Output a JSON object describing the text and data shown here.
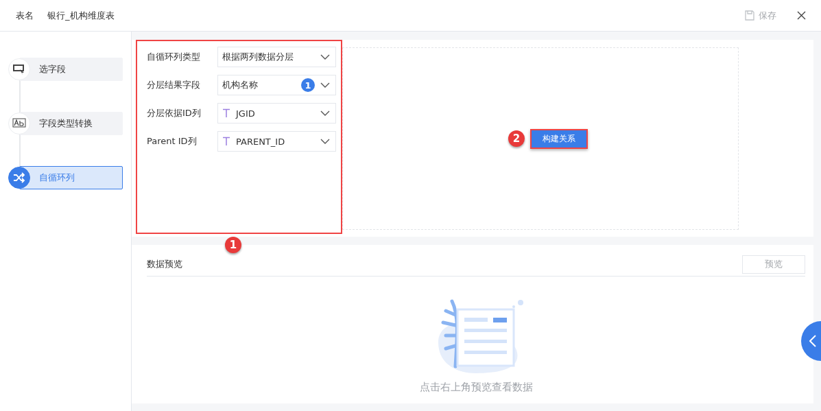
{
  "header": {
    "label": "表名",
    "table_name": "银行_机构维度表",
    "save": "保存"
  },
  "steps": [
    {
      "label": "选字段",
      "kind": "select",
      "selected": false
    },
    {
      "label": "字段类型转换",
      "kind": "convert",
      "selected": false
    },
    {
      "label": "自循环列",
      "kind": "shuffle",
      "selected": true
    }
  ],
  "form": {
    "marker": "1",
    "fields": [
      {
        "label": "自循环列类型",
        "value": "根据两列数据分层",
        "kind": "plain"
      },
      {
        "label": "分层结果字段",
        "value": "机构名称",
        "kind": "plain",
        "marker": "1"
      },
      {
        "label": "分层依据ID列",
        "value": "JGID",
        "kind": "text"
      },
      {
        "label": "Parent ID列",
        "value": "PARENT_ID",
        "kind": "text"
      }
    ]
  },
  "build": {
    "label": "构建关系",
    "marker": "2"
  },
  "preview": {
    "title": "数据预览",
    "button": "预览",
    "empty": "点击右上角预览查看数据"
  }
}
